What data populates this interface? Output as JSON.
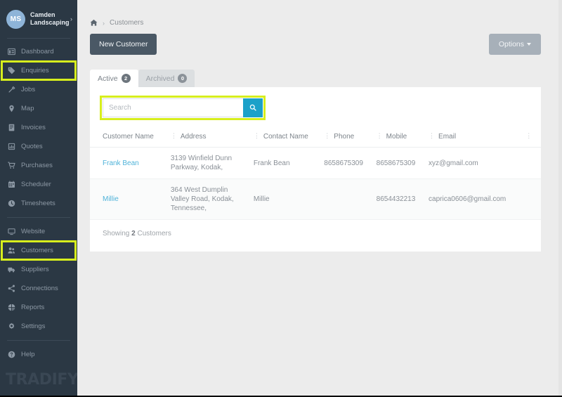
{
  "sidebar": {
    "brand": {
      "initials": "MS",
      "name": "Camden Landscaping",
      "caret": "›"
    },
    "items": [
      {
        "label": "Dashboard",
        "icon": "dashboard-icon",
        "highlighted": false
      },
      {
        "label": "Enquiries",
        "icon": "tag-icon",
        "highlighted": true
      },
      {
        "label": "Jobs",
        "icon": "wrench-icon",
        "highlighted": false
      },
      {
        "label": "Map",
        "icon": "map-pin-icon",
        "highlighted": false
      },
      {
        "label": "Invoices",
        "icon": "invoice-icon",
        "highlighted": false
      },
      {
        "label": "Quotes",
        "icon": "quotes-icon",
        "highlighted": false
      },
      {
        "label": "Purchases",
        "icon": "cart-icon",
        "highlighted": false
      },
      {
        "label": "Scheduler",
        "icon": "calendar-icon",
        "highlighted": false
      },
      {
        "label": "Timesheets",
        "icon": "clock-icon",
        "highlighted": false
      },
      {
        "label": "Website",
        "icon": "monitor-icon",
        "highlighted": false
      },
      {
        "label": "Customers",
        "icon": "customers-icon",
        "highlighted": true
      },
      {
        "label": "Suppliers",
        "icon": "truck-icon",
        "highlighted": false
      },
      {
        "label": "Connections",
        "icon": "share-icon",
        "highlighted": false
      },
      {
        "label": "Reports",
        "icon": "pie-chart-icon",
        "highlighted": false
      },
      {
        "label": "Settings",
        "icon": "gear-icon",
        "highlighted": false
      },
      {
        "label": "Help",
        "icon": "help-icon",
        "highlighted": false
      }
    ],
    "footer_logo": "TRADIFY"
  },
  "breadcrumb": {
    "home_icon": "home-icon",
    "separator": "›",
    "current": "Customers"
  },
  "toolbar": {
    "new_customer_label": "New Customer",
    "options_label": "Options"
  },
  "tabs": [
    {
      "label": "Active",
      "count": "2",
      "selected": true
    },
    {
      "label": "Archived",
      "count": "0",
      "selected": false
    }
  ],
  "search": {
    "placeholder": "Search",
    "value": "",
    "icon": "search-icon"
  },
  "table": {
    "columns": [
      {
        "label": "Customer Name",
        "sortable": false
      },
      {
        "label": "Address",
        "sortable": true
      },
      {
        "label": "Contact Name",
        "sortable": true
      },
      {
        "label": "Phone",
        "sortable": true
      },
      {
        "label": "Mobile",
        "sortable": true
      },
      {
        "label": "Email",
        "sortable": true
      },
      {
        "label": "",
        "sortable": true
      }
    ],
    "rows": [
      {
        "customer_name": "Frank Bean",
        "address": "3139 Winfield Dunn Parkway, Kodak,",
        "contact_name": "Frank Bean",
        "phone": "8658675309",
        "mobile": "8658675309",
        "email": "xyz@gmail.com"
      },
      {
        "customer_name": "Millie",
        "address": "364 West Dumplin Valley Road, Kodak, Tennessee,",
        "contact_name": "Millie",
        "phone": "",
        "mobile": "8654432213",
        "email": "caprica0606@gmail.com"
      }
    ]
  },
  "footer": {
    "showing_prefix": "Showing",
    "showing_count": "2",
    "showing_suffix": "Customers"
  },
  "colors": {
    "sidebar_bg": "#2b3844",
    "highlight": "#d7ee1d",
    "accent_link": "#4fb3d9",
    "search_button": "#1ca1c9",
    "primary_button": "#4a5865",
    "secondary_button": "#a7b0b9"
  }
}
